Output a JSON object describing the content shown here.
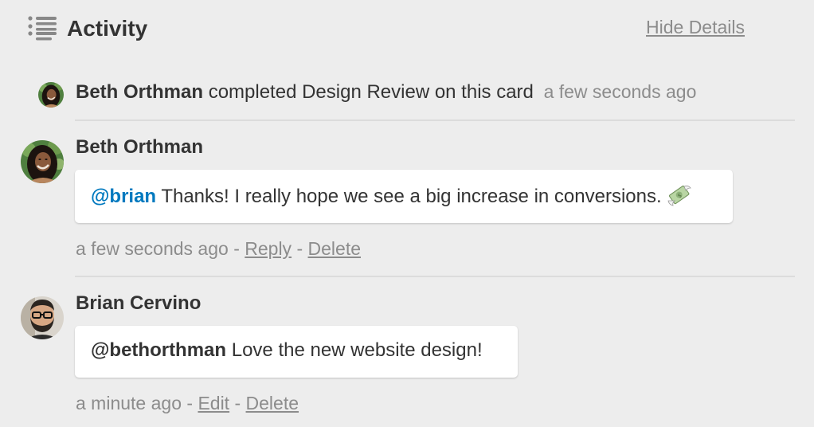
{
  "header": {
    "icon": "activity-list-icon",
    "title": "Activity",
    "hide_details_label": "Hide Details"
  },
  "action": {
    "member": "Beth Orthman",
    "text": "completed Design Review on this card",
    "time": "a few seconds ago",
    "avatar": "avatar-beth"
  },
  "comments": [
    {
      "author": "Beth Orthman",
      "avatar": "avatar-beth",
      "mention": "@brian",
      "text": "Thanks! I really hope we see a big increase in conversions.",
      "emoji": "money-with-wings-icon",
      "time": "a few seconds ago",
      "sep": "-",
      "actions": [
        "Reply",
        "Delete"
      ]
    },
    {
      "author": "Brian Cervino",
      "avatar": "avatar-brian",
      "mention": "@bethorthman",
      "text": "Love the new website design!",
      "time": "a minute ago",
      "sep": "-",
      "actions": [
        "Edit",
        "Delete"
      ]
    }
  ],
  "colors": {
    "background": "#ededed",
    "mention_link": "#0079bf",
    "muted_text": "#8c8c8c",
    "text": "#333333"
  }
}
